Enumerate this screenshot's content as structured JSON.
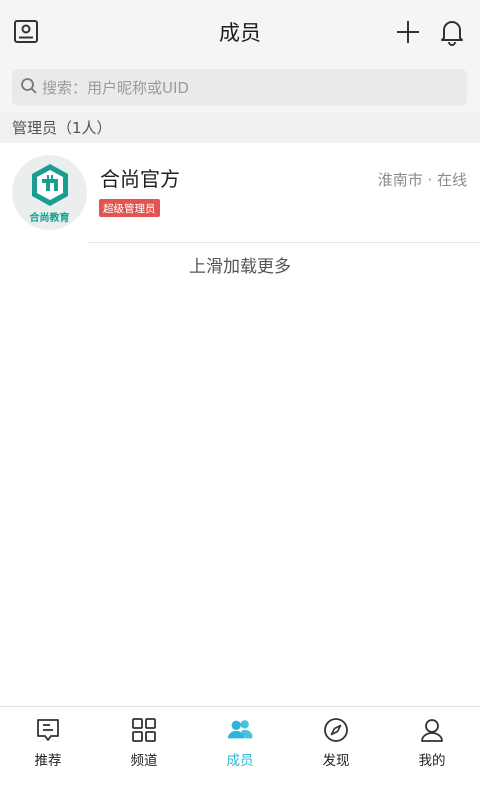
{
  "header": {
    "title": "成员"
  },
  "search": {
    "placeholder": "搜索：用户昵称或UID"
  },
  "admin_section": {
    "title": "管理员（1人）"
  },
  "members": [
    {
      "name": "合尚官方",
      "avatar_caption": "合尚教育",
      "role_badge": "超级管理员",
      "meta": "淮南市 · 在线"
    }
  ],
  "load_more": "上滑加载更多",
  "tabs": [
    {
      "label": "推荐",
      "icon": "recommend-icon"
    },
    {
      "label": "频道",
      "icon": "grid-icon"
    },
    {
      "label": "成员",
      "icon": "members-icon",
      "active": true
    },
    {
      "label": "发现",
      "icon": "compass-icon"
    },
    {
      "label": "我的",
      "icon": "profile-icon"
    }
  ],
  "colors": {
    "accent": "#2bb7d6",
    "badge": "#e2544f",
    "logo": "#1a9e92"
  }
}
